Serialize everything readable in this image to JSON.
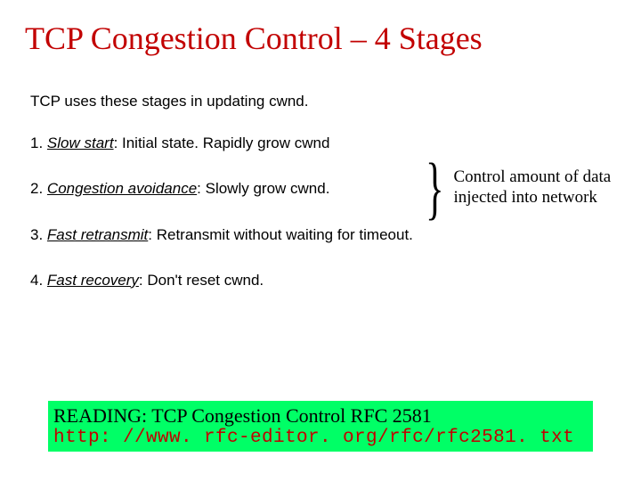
{
  "title": "TCP Congestion Control – 4 Stages",
  "intro": "TCP uses these stages in updating cwnd.",
  "stages": [
    {
      "num": "1.",
      "name": "Slow start",
      "desc": ":  Initial state. Rapidly grow cwnd"
    },
    {
      "num": "2.",
      "name": "Congestion avoidance",
      "desc": ": Slowly grow cwnd."
    },
    {
      "num": "3.",
      "name": "Fast retransmit",
      "desc": ": Retransmit without waiting for timeout."
    },
    {
      "num": "4.",
      "name": "Fast recovery",
      "desc": ": Don't reset cwnd."
    }
  ],
  "brace": {
    "glyph": "}",
    "note": "Control amount of data injected into network"
  },
  "reading": {
    "label": "READING: TCP Congestion Control RFC 2581",
    "url": "http: //www. rfc-editor. org/rfc/rfc2581. txt"
  }
}
